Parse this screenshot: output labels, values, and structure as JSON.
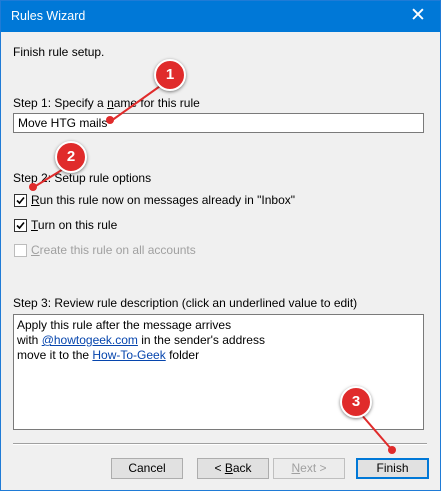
{
  "window": {
    "title": "Rules Wizard",
    "close_glyph": "✕"
  },
  "heading": "Finish rule setup.",
  "step1": {
    "label_pre": "Step 1: Specify a ",
    "label_key": "n",
    "label_post": "ame for this rule",
    "name_value": "Move HTG mails"
  },
  "step2": {
    "label": "Step 2: Setup rule options",
    "options": [
      {
        "key": "R",
        "rest": "un this rule now on messages already in \"Inbox\"",
        "checked": true,
        "enabled": true
      },
      {
        "key": "T",
        "rest": "urn on this rule",
        "checked": true,
        "enabled": true
      },
      {
        "key": "C",
        "rest": "reate this rule on all accounts",
        "checked": false,
        "enabled": false
      }
    ]
  },
  "step3": {
    "label": "Step 3: Review rule description (click an underlined value to edit)",
    "line1": "Apply this rule after the message arrives",
    "line2_pre": "with ",
    "line2_link": "@howtogeek.com",
    "line2_post": " in the sender's address",
    "line3_pre": "move it to the ",
    "line3_link": "How-To-Geek",
    "line3_post": " folder"
  },
  "buttons": {
    "cancel": "Cancel",
    "back_pre": "< ",
    "back_key": "B",
    "back_post": "ack",
    "next_pre": "",
    "next_key": "N",
    "next_post": "ext >",
    "finish": "Finish"
  },
  "markers": [
    "1",
    "2",
    "3"
  ],
  "colors": {
    "titlebar": "#0078d7",
    "marker": "#e02b2b",
    "link": "#0645ad"
  }
}
